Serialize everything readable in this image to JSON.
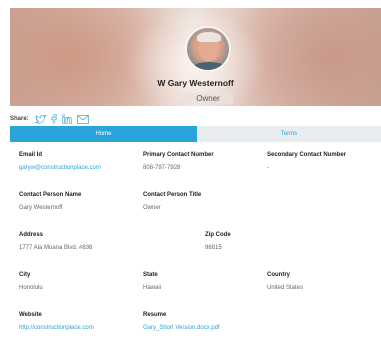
{
  "profile": {
    "name": "W Gary Westernoff",
    "role": "Owner"
  },
  "share": {
    "label": "Share:",
    "icons": [
      "twitter-icon",
      "facebook-icon",
      "linkedin-icon",
      "email-icon"
    ]
  },
  "tabs": [
    {
      "label": "Home",
      "active": true
    },
    {
      "label": "Terms",
      "active": false
    }
  ],
  "details": {
    "email": {
      "label": "Email Id",
      "value": "garyw@constructionplace.com"
    },
    "primary_contact": {
      "label": "Primary Contact Number",
      "value": "808-797-7928"
    },
    "secondary_contact": {
      "label": "Secondary Contact Number",
      "value": "-"
    },
    "contact_person_name": {
      "label": "Contact Person Name",
      "value": "Gary Westernoff"
    },
    "contact_person_title": {
      "label": "Contact Person Title",
      "value": "Owner"
    },
    "address": {
      "label": "Address",
      "value": "1777 Ala Moana Blvd. #836"
    },
    "zip": {
      "label": "Zip Code",
      "value": "96815"
    },
    "city": {
      "label": "City",
      "value": "Honolulu"
    },
    "state": {
      "label": "State",
      "value": "Hawaii"
    },
    "country": {
      "label": "Country",
      "value": "United States"
    },
    "website": {
      "label": "Website",
      "value": "http://constructionplace.com"
    },
    "resume": {
      "label": "Resume",
      "value": "Gary_Short Version.docx.pdf"
    }
  },
  "colors": {
    "accent": "#2aa3db",
    "tab_inactive_bg": "#e9edf0"
  }
}
